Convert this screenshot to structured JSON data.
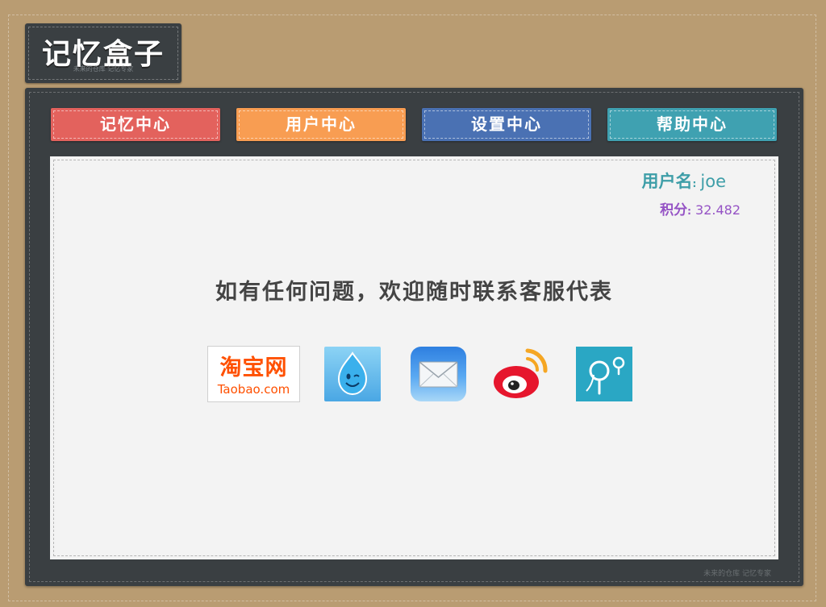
{
  "logo": {
    "title": "记忆盒子",
    "subtitle": "未来的仓库 记忆专家"
  },
  "nav": {
    "items": [
      {
        "label": "记忆中心",
        "color": "#e3625d"
      },
      {
        "label": "用户中心",
        "color": "#f89d52"
      },
      {
        "label": "设置中心",
        "color": "#4a71b3"
      },
      {
        "label": "帮助中心",
        "color": "#3fa1b1"
      }
    ]
  },
  "user": {
    "name_label": "用户名",
    "colon": ":",
    "name": "joe",
    "score_label": "积分",
    "score": "32.482"
  },
  "main": {
    "message": "如有任何问题，欢迎随时联系客服代表"
  },
  "contacts": {
    "taobao_cn": "淘宝网",
    "taobao_en": "Taobao.com",
    "icons": [
      "taobao-icon",
      "wangwang-icon",
      "mail-icon",
      "weibo-icon",
      "pp-icon"
    ]
  },
  "footer": {
    "text": "未来的仓库 记忆专家"
  }
}
